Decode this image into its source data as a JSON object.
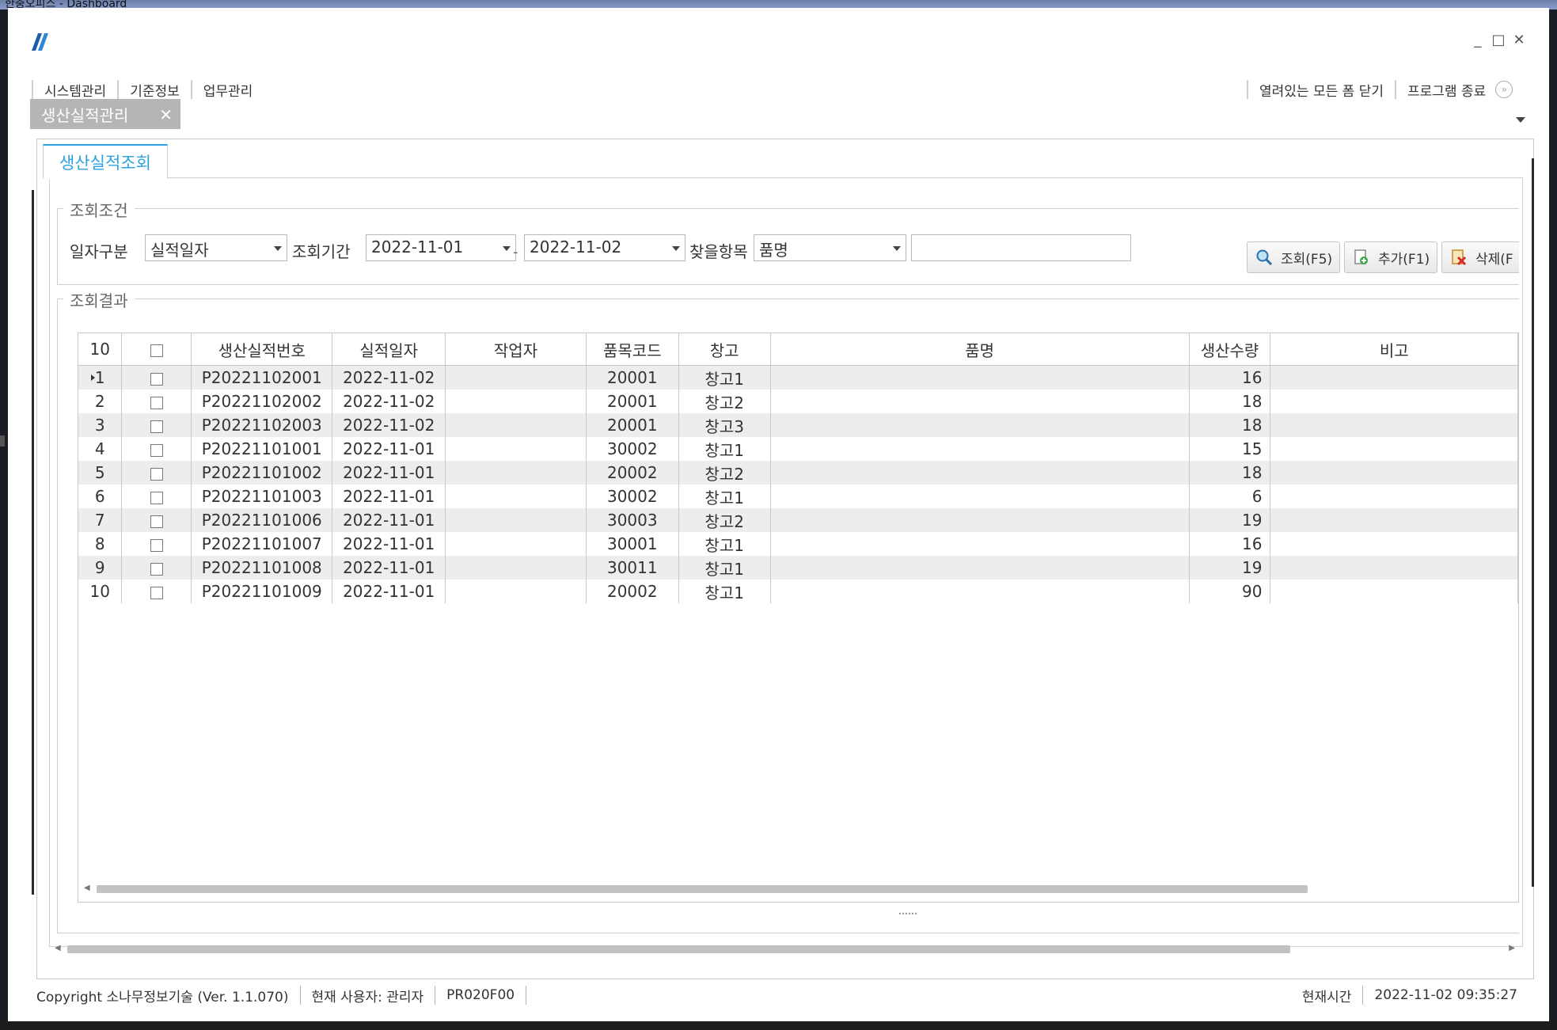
{
  "desktop": {
    "title": "한충오피스 - Dashboard"
  },
  "window": {
    "controls": {
      "minimize": "_",
      "maximize": "□",
      "close": "✕"
    }
  },
  "menu": {
    "left": [
      "시스템관리",
      "기준정보",
      "업무관리"
    ],
    "close_all": "열려있는 모든 폼 닫기",
    "exit": "프로그램 종료",
    "exit_icon": "»"
  },
  "doc_tab": {
    "label": "생산실적관리",
    "close": "✕"
  },
  "inner_tab": {
    "label": "생산실적조회"
  },
  "search": {
    "group_title": "조회조건",
    "date_type_label": "일자구분",
    "date_type_value": "실적일자",
    "period_label": "조회기간",
    "date_from": "2022-11-01",
    "date_separator": "-",
    "date_to": "2022-11-02",
    "find_label": "찾을항목",
    "find_value": "품명",
    "find_text": "",
    "buttons": {
      "search": "조회(F5)",
      "add": "추가(F1)",
      "delete": "삭제(F"
    }
  },
  "result": {
    "group_title": "조회결과",
    "row_count": "10",
    "columns": [
      "생산실적번호",
      "실적일자",
      "작업자",
      "품목코드",
      "창고",
      "품명",
      "생산수량",
      "비고"
    ],
    "rows": [
      {
        "no": "1",
        "id": "P20221102001",
        "date": "2022-11-02",
        "worker": "",
        "code": "20001",
        "wh": "창고1",
        "name": "",
        "qty": "16",
        "note": ""
      },
      {
        "no": "2",
        "id": "P20221102002",
        "date": "2022-11-02",
        "worker": "",
        "code": "20001",
        "wh": "창고2",
        "name": "",
        "qty": "18",
        "note": ""
      },
      {
        "no": "3",
        "id": "P20221102003",
        "date": "2022-11-02",
        "worker": "",
        "code": "20001",
        "wh": "창고3",
        "name": "",
        "qty": "18",
        "note": ""
      },
      {
        "no": "4",
        "id": "P20221101001",
        "date": "2022-11-01",
        "worker": "",
        "code": "30002",
        "wh": "창고1",
        "name": "",
        "qty": "15",
        "note": ""
      },
      {
        "no": "5",
        "id": "P20221101002",
        "date": "2022-11-01",
        "worker": "",
        "code": "20002",
        "wh": "창고2",
        "name": "",
        "qty": "18",
        "note": ""
      },
      {
        "no": "6",
        "id": "P20221101003",
        "date": "2022-11-01",
        "worker": "",
        "code": "30002",
        "wh": "창고1",
        "name": "",
        "qty": "6",
        "note": ""
      },
      {
        "no": "7",
        "id": "P20221101006",
        "date": "2022-11-01",
        "worker": "",
        "code": "30003",
        "wh": "창고2",
        "name": "",
        "qty": "19",
        "note": ""
      },
      {
        "no": "8",
        "id": "P20221101007",
        "date": "2022-11-01",
        "worker": "",
        "code": "30001",
        "wh": "창고1",
        "name": "",
        "qty": "16",
        "note": ""
      },
      {
        "no": "9",
        "id": "P20221101008",
        "date": "2022-11-01",
        "worker": "",
        "code": "30011",
        "wh": "창고1",
        "name": "",
        "qty": "19",
        "note": ""
      },
      {
        "no": "10",
        "id": "P20221101009",
        "date": "2022-11-01",
        "worker": "",
        "code": "20002",
        "wh": "창고1",
        "name": "",
        "qty": "90",
        "note": ""
      }
    ]
  },
  "status": {
    "copyright": "Copyright 소나무정보기술 (Ver. 1.1.070)",
    "user": "현재 사용자: 관리자",
    "form_id": "PR020F00",
    "time_label": "현재시간",
    "time_value": "2022-11-02 09:35:27"
  },
  "colors": {
    "accent": "#2fa2e0",
    "tab_bg": "#b5b5b5",
    "row_alt": "#ededed"
  }
}
